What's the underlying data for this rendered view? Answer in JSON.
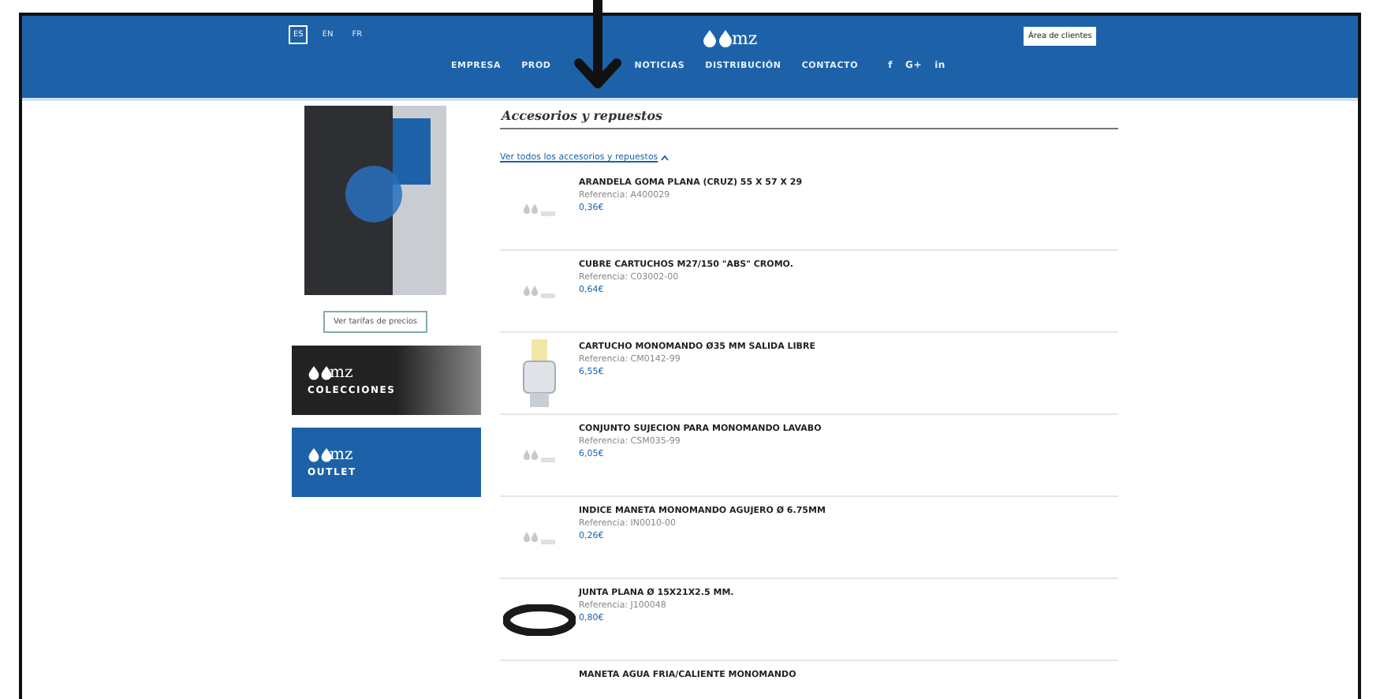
{
  "header": {
    "languages": [
      {
        "label": "ES",
        "selected": true
      },
      {
        "label": "EN",
        "selected": false
      },
      {
        "label": "FR",
        "selected": false
      }
    ],
    "logo": "mz",
    "client_button": "Área de clientes",
    "nav": [
      "EMPRESA",
      "PROD",
      "NOTICIAS",
      "DISTRIBUCIÓN",
      "CONTACTO"
    ],
    "social": [
      "f",
      "G+",
      "in"
    ]
  },
  "sidebar": {
    "catalog_button": "Ver tarifas de precios",
    "banners": [
      {
        "logo": "mz",
        "label": "COLECCIONES",
        "kind": "dark"
      },
      {
        "logo": "mz",
        "label": "OUTLET",
        "kind": "blue"
      }
    ]
  },
  "main": {
    "title": "Accesorios y repuestos",
    "link": "Ver todos los accesorios y repuestos",
    "products": [
      {
        "name": "ARANDELA GOMA PLANA (CRUZ) 55 X 57 X 29",
        "reference": "Referencia: A400029",
        "price": "0,36€",
        "kind": "placeholder"
      },
      {
        "name": "CUBRE CARTUCHOS M27/150 \"ABS\" CROMO.",
        "reference": "Referencia: C03002-00",
        "price": "0,64€",
        "kind": "placeholder"
      },
      {
        "name": "CARTUCHO MONOMANDO Ø35 MM SALIDA LIBRE",
        "reference": "Referencia: CM0142-99",
        "price": "6,55€",
        "kind": "cartridge"
      },
      {
        "name": "CONJUNTO SUJECION PARA MONOMANDO LAVABO",
        "reference": "Referencia: CSM035-99",
        "price": "6,05€",
        "kind": "placeholder"
      },
      {
        "name": "INDICE MANETA MONOMANDO AGUJERO Ø 6.75MM",
        "reference": "Referencia: IN0010-00",
        "price": "0,26€",
        "kind": "placeholder"
      },
      {
        "name": "JUNTA PLANA Ø 15X21X2.5 MM.",
        "reference": "Referencia: J100048",
        "price": "0,80€",
        "kind": "ring"
      },
      {
        "name": "MANETA AGUA FRIA/CALIENTE MONOMANDO",
        "kind": "none"
      }
    ]
  }
}
